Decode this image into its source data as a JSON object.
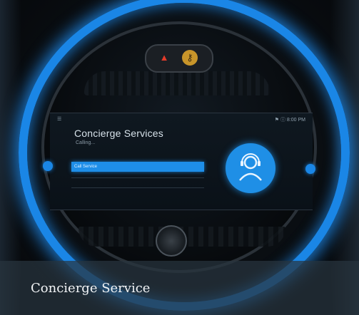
{
  "screen": {
    "title": "Concierge Services",
    "subtitle": "Calling...",
    "status_left": "☰",
    "status_right": "⚑   ⓘ  8:00 PM",
    "menu_item": "Call Service"
  },
  "caption": {
    "text": "Concierge Service"
  },
  "colors": {
    "ambient_ring": "#1a86e6",
    "hazard": "#e23b2a",
    "key": "#c8952a"
  },
  "icons": {
    "hazard": "warning-triangle-icon",
    "key": "key-icon",
    "avatar": "person-headset-icon"
  }
}
